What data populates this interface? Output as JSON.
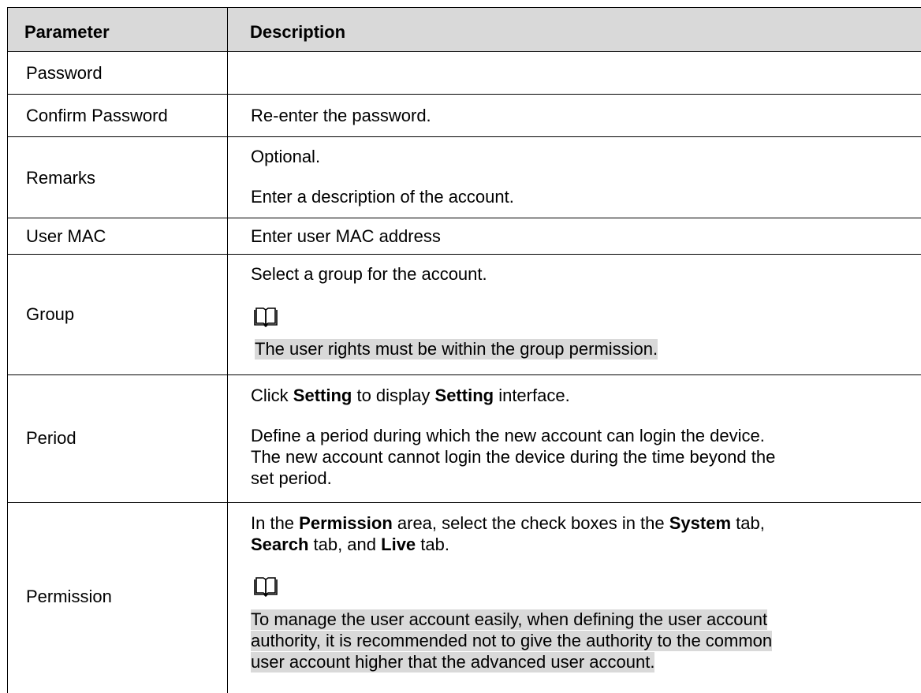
{
  "header": {
    "parameter": "Parameter",
    "description": "Description"
  },
  "rows": [
    {
      "param": "Password",
      "desc": []
    },
    {
      "param": "Confirm Password",
      "desc": [
        "Re-enter the password."
      ]
    },
    {
      "param": "Remarks",
      "desc": [
        "Optional.",
        "Enter a description of the account."
      ]
    },
    {
      "param": "User MAC",
      "desc": [
        "Enter user MAC address"
      ]
    },
    {
      "param": "Group",
      "desc": [
        "Select a group for the account."
      ],
      "note": "The user rights must be within the group permission."
    },
    {
      "param": "Period"
    },
    {
      "param": "Permission"
    }
  ],
  "period": {
    "l1a": "Click ",
    "l1b": "Setting",
    "l1c": " to display ",
    "l1d": "Setting",
    "l1e": " interface.",
    "p2l1": "Define a period during which the new account can login the device.",
    "p2l2": "The new account cannot login the device during the time beyond the",
    "p2l3": "set period."
  },
  "permission": {
    "l1a": "In the ",
    "l1b": "Permission",
    "l1c": " area, select the check boxes in the ",
    "l1d": "System",
    "l1e": " tab,",
    "l2a": "Search",
    "l2b": " tab, and ",
    "l2c": "Live",
    "l2d": " tab.",
    "note1": "To manage the user account easily, when defining the user account",
    "note2": "authority, it is recommended not to give the authority to the common",
    "note3": "user account higher that the advanced user account."
  },
  "icons": {
    "note": "book-icon"
  }
}
